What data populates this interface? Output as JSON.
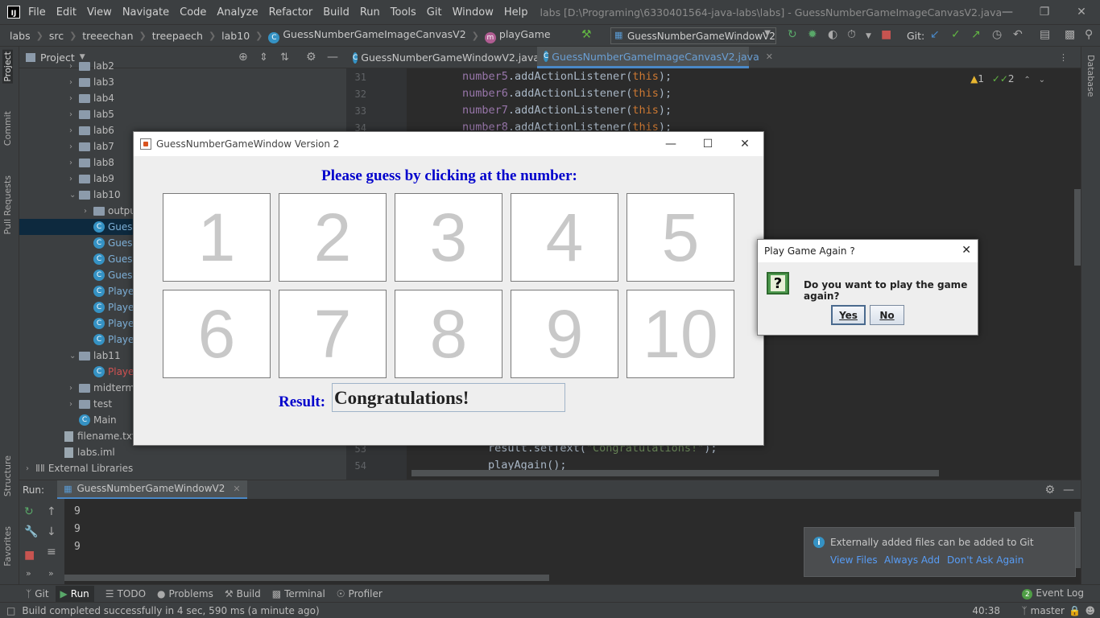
{
  "titlebar": {
    "logo": "IJ",
    "menu": [
      "File",
      "Edit",
      "View",
      "Navigate",
      "Code",
      "Analyze",
      "Refactor",
      "Build",
      "Run",
      "Tools",
      "Git",
      "Window",
      "Help"
    ],
    "title": "labs [D:\\Programing\\6330401564-java-labs\\labs] - GuessNumberGameImageCanvasV2.java"
  },
  "navbar": {
    "crumbs": [
      "labs",
      "src",
      "treeechan",
      "treepaech",
      "lab10",
      "GuessNumberGameImageCanvasV2",
      "playGame"
    ],
    "run_config": "GuessNumberGameWindowV2",
    "git_label": "Git:"
  },
  "leftstrip": {
    "tabs": [
      "Project",
      "Commit",
      "Pull Requests",
      "Structure",
      "Favorites"
    ]
  },
  "project": {
    "header": "Project",
    "rows": [
      {
        "label": "lab2",
        "kind": "folder",
        "depth": 3,
        "arrow": "›"
      },
      {
        "label": "lab3",
        "kind": "folder",
        "depth": 3,
        "arrow": "›"
      },
      {
        "label": "lab4",
        "kind": "folder",
        "depth": 3,
        "arrow": "›"
      },
      {
        "label": "lab5",
        "kind": "folder",
        "depth": 3,
        "arrow": "›"
      },
      {
        "label": "lab6",
        "kind": "folder",
        "depth": 3,
        "arrow": "›"
      },
      {
        "label": "lab7",
        "kind": "folder",
        "depth": 3,
        "arrow": "›"
      },
      {
        "label": "lab8",
        "kind": "folder",
        "depth": 3,
        "arrow": "›"
      },
      {
        "label": "lab9",
        "kind": "folder",
        "depth": 3,
        "arrow": "›"
      },
      {
        "label": "lab10",
        "kind": "folder",
        "depth": 3,
        "arrow": "⌄"
      },
      {
        "label": "outpu",
        "kind": "folder",
        "depth": 4,
        "arrow": "›"
      },
      {
        "label": "Gues",
        "kind": "java",
        "depth": 4,
        "arrow": "",
        "selected": true
      },
      {
        "label": "Gues",
        "kind": "java",
        "depth": 4,
        "arrow": ""
      },
      {
        "label": "Gues",
        "kind": "java",
        "depth": 4,
        "arrow": ""
      },
      {
        "label": "Gues",
        "kind": "java",
        "depth": 4,
        "arrow": ""
      },
      {
        "label": "Playe",
        "kind": "java",
        "depth": 4,
        "arrow": ""
      },
      {
        "label": "Playe",
        "kind": "java",
        "depth": 4,
        "arrow": ""
      },
      {
        "label": "Playe",
        "kind": "java",
        "depth": 4,
        "arrow": ""
      },
      {
        "label": "Playe",
        "kind": "java",
        "depth": 4,
        "arrow": ""
      },
      {
        "label": "lab11",
        "kind": "folder",
        "depth": 3,
        "arrow": "⌄"
      },
      {
        "label": "Playe",
        "kind": "java",
        "depth": 4,
        "arrow": "",
        "error": true
      },
      {
        "label": "midterm",
        "kind": "folder",
        "depth": 3,
        "arrow": "›"
      },
      {
        "label": "test",
        "kind": "folder",
        "depth": 3,
        "arrow": "›"
      },
      {
        "label": "Main",
        "kind": "java",
        "depth": 3,
        "arrow": ""
      },
      {
        "label": "filename.txt",
        "kind": "txt",
        "depth": 2,
        "arrow": ""
      },
      {
        "label": "labs.iml",
        "kind": "txt",
        "depth": 2,
        "arrow": ""
      },
      {
        "label": "External Libraries",
        "kind": "lib",
        "depth": 0,
        "arrow": "›"
      }
    ]
  },
  "editor": {
    "tabs": [
      {
        "label": "GuessNumberGameWindowV2.java",
        "active": false
      },
      {
        "label": "GuessNumberGameImageCanvasV2.java",
        "active": true
      }
    ],
    "inspections": {
      "warnings": "1",
      "weak": "2"
    },
    "lines_top": [
      {
        "num": "31",
        "obj": "number5",
        "call": ".addActionListener(",
        "arg": "this",
        "end": ");"
      },
      {
        "num": "32",
        "obj": "number6",
        "call": ".addActionListener(",
        "arg": "this",
        "end": ");"
      },
      {
        "num": "33",
        "obj": "number7",
        "call": ".addActionListener(",
        "arg": "this",
        "end": ");"
      },
      {
        "num": "34",
        "obj": "number8",
        "call": ".addActionListener(",
        "arg": "this",
        "end": ");"
      }
    ],
    "lines_bottom": [
      {
        "num": "53",
        "text_a": "result.setText(",
        "text_s": "\"Congratulations!\"",
        "text_b": ");"
      },
      {
        "num": "54",
        "text_a": "playAgain();",
        "text_s": "",
        "text_b": ""
      }
    ]
  },
  "rightstrip": {
    "tab": "Database"
  },
  "run": {
    "label": "Run:",
    "tab": "GuessNumberGameWindowV2",
    "output": [
      "9",
      "9",
      "9"
    ]
  },
  "toast": {
    "message": "Externally added files can be added to Git",
    "links": [
      "View Files",
      "Always Add",
      "Don't Ask Again"
    ]
  },
  "bottombar": {
    "tabs": [
      "Git",
      "Run",
      "TODO",
      "Problems",
      "Build",
      "Terminal",
      "Profiler"
    ],
    "event_log": "Event Log",
    "event_count": "2"
  },
  "statusbar": {
    "message": "Build completed successfully in 4 sec, 590 ms (a minute ago)",
    "position": "40:38",
    "branch": "master"
  },
  "game_window": {
    "title": "GuessNumberGameWindow Version 2",
    "prompt": "Please guess by clicking at the number:",
    "numbers": [
      "1",
      "2",
      "3",
      "4",
      "5",
      "6",
      "7",
      "8",
      "9",
      "10"
    ],
    "result_label": "Result:",
    "result_value": "Congratulations!"
  },
  "dialog": {
    "title": "Play Game Again ?",
    "icon": "?",
    "message": "Do you want to play the game again?",
    "yes": "Yes",
    "no": "No"
  },
  "colors": {
    "accent_blue": "#4a88c7",
    "prompt_blue": "#0000cc"
  }
}
